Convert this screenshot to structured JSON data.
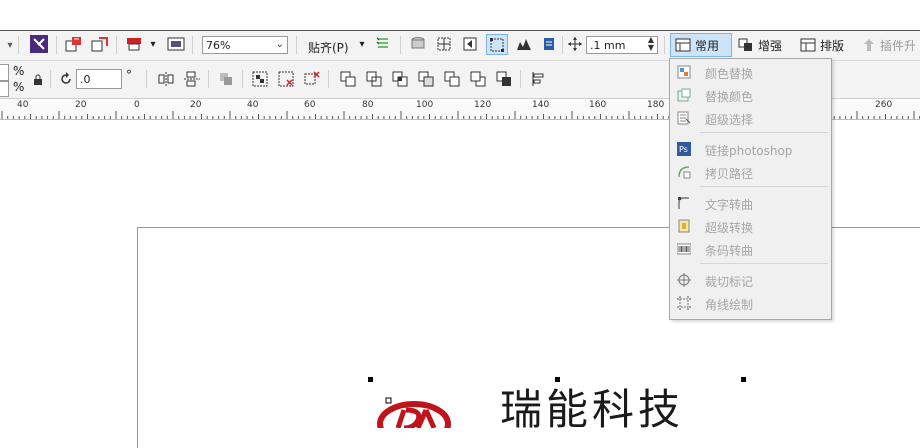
{
  "toolbar1": {
    "zoom_value": "76%",
    "snap_label": "贴齐(P)",
    "nudge_value": ".1 mm",
    "tabs": [
      {
        "label": "常用",
        "active": true
      },
      {
        "label": "增强",
        "active": false
      },
      {
        "label": "排版",
        "active": false
      },
      {
        "label": "插件升",
        "active": false
      }
    ]
  },
  "toolbar2": {
    "percent_top": "%",
    "percent_bottom": "%",
    "angle_value": ".0",
    "degree_symbol": "°"
  },
  "ruler": {
    "ticks": [
      "40",
      "20",
      "0",
      "20",
      "40",
      "60",
      "80",
      "100",
      "120",
      "140",
      "160",
      "180",
      "260"
    ]
  },
  "dropdown_menu": {
    "items": [
      {
        "label": "颜色替换",
        "icon": "color-replace-icon"
      },
      {
        "label": "替换颜色",
        "icon": "replace-color-icon"
      },
      {
        "label": "超级选择",
        "icon": "super-select-icon"
      },
      {
        "label": "链接photoshop",
        "icon": "photoshop-icon"
      },
      {
        "label": "拷贝路径",
        "icon": "copy-path-icon"
      },
      {
        "label": "文字转曲",
        "icon": "text-to-curve-icon"
      },
      {
        "label": "超级转换",
        "icon": "super-convert-icon"
      },
      {
        "label": "条码转曲",
        "icon": "barcode-curve-icon"
      },
      {
        "label": "裁切标记",
        "icon": "crop-mark-icon"
      },
      {
        "label": "角线绘制",
        "icon": "corner-line-icon"
      }
    ]
  },
  "canvas": {
    "logo_text": "瑞能科技",
    "logo_mark": "RD",
    "brand_color": "#c0141c"
  },
  "colors": {
    "accent_tab": "#cde4f7",
    "menu_text_disabled": "#a6a6a6"
  }
}
